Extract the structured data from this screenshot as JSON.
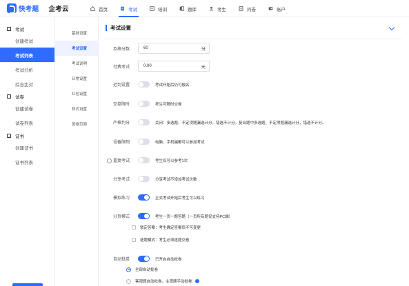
{
  "brand": {
    "name": "快考题",
    "sub": "企考云"
  },
  "nav": [
    {
      "label": "首页",
      "icon": "home-icon"
    },
    {
      "label": "考试",
      "icon": "exam-icon"
    },
    {
      "label": "培训",
      "icon": "training-icon"
    },
    {
      "label": "题库",
      "icon": "question-bank-icon"
    },
    {
      "label": "考生",
      "icon": "candidate-icon"
    },
    {
      "label": "问卷",
      "icon": "survey-icon"
    },
    {
      "label": "账户",
      "icon": "account-icon"
    }
  ],
  "sidebar": {
    "sections": [
      {
        "title": "考试",
        "items": [
          "创建考试",
          "考试列表",
          "考试分析",
          "综合比对"
        ]
      },
      {
        "title": "试卷",
        "items": [
          "创建试卷",
          "试卷列表"
        ]
      },
      {
        "title": "证书",
        "items": [
          "创建证书",
          "证书列表"
        ]
      }
    ]
  },
  "submenu": [
    "基础设置",
    "考试设置",
    "考试说明",
    "日常设置",
    "红包设置",
    "样式设置",
    "答卷页面"
  ],
  "panel": {
    "title": "考试设置",
    "pass_score": {
      "label": "及格分数",
      "value": "60",
      "unit": "分"
    },
    "paid_exam": {
      "label": "付费考试",
      "value": "0.00",
      "unit": "元"
    },
    "settings": [
      {
        "label": "迟到设置",
        "on": false,
        "desc": "考试开始后仍可报名"
      },
      {
        "label": "交卷限时",
        "on": false,
        "desc": "考生可随时交卷"
      },
      {
        "label": "严格判分",
        "on": false,
        "desc": "关闭：多选题、不定项题漏选计分，错选不计分。复合题中多选题、不定项题漏选计分，错选不计分。"
      },
      {
        "label": "设备限制",
        "on": false,
        "desc": "电脑、手机端都可以参加考试"
      },
      {
        "label": "重复考试",
        "on": false,
        "desc": "考生仅可以参考1次"
      },
      {
        "label": "分享考试",
        "on": false,
        "desc": "分享考试不增加考试次数"
      },
      {
        "label": "模拟练习",
        "on": true,
        "desc": "正式考试开始后考生可以练习"
      },
      {
        "label": "分页模式",
        "on": true,
        "desc": "考生一页一题答题（一页所有题仅支持PC端）"
      }
    ],
    "page_mode_options": [
      "锁定答案：考生确定答案后不可变更",
      "逐题模式：考生必须逐题交卷"
    ],
    "auto_grade": {
      "label": "自动批卷",
      "on": true,
      "desc": "已开启自动批卷"
    },
    "auto_grade_options": [
      "全部自动批卷",
      "客观题自动批卷，主观题手动批卷"
    ]
  },
  "colors": {
    "accent": "#2f6bff"
  }
}
